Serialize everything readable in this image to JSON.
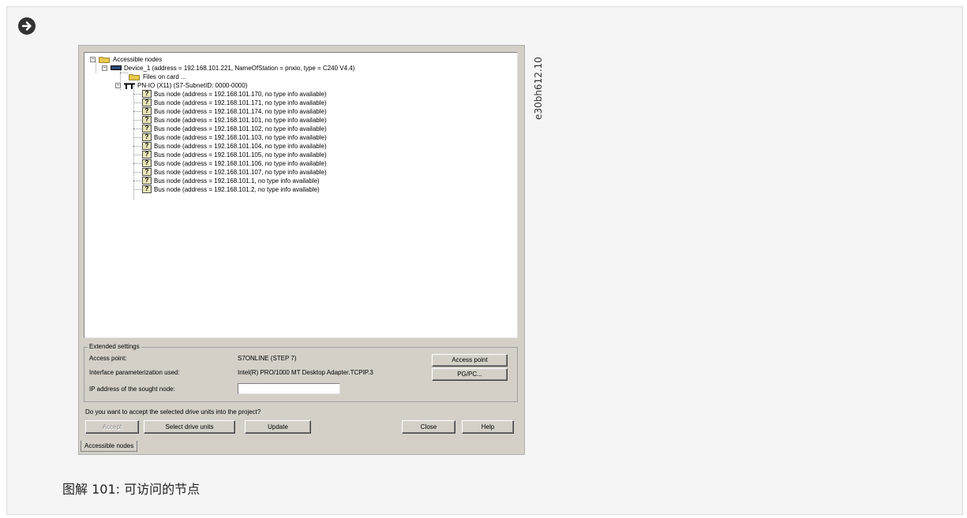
{
  "watermark": "e30bh612.10",
  "caption": "图解 101: 可访问的节点",
  "tree": {
    "root": "Accessible nodes",
    "device": "Device_1 (address = 192.168.101.221, NameOfStation = pnxio, type = C240 V4.4)",
    "files": "Files on card ...",
    "pnio": "PN-IO (X11) (S7-SubnetID: 0000-0000)",
    "bus_nodes": [
      "Bus node (address = 192.168.101.170, no type info available)",
      "Bus node (address = 192.168.101.171, no type info available)",
      "Bus node (address = 192.168.101.174, no type info available)",
      "Bus node (address = 192.168.101.101, no type info available)",
      "Bus node (address = 192.168.101.102, no type info available)",
      "Bus node (address = 192.168.101.103, no type info available)",
      "Bus node (address = 192.168.101.104, no type info available)",
      "Bus node (address = 192.168.101.105, no type info available)",
      "Bus node (address = 192.168.101.106, no type info available)",
      "Bus node (address = 192.168.101.107, no type info available)",
      "Bus node (address = 192.168.101.1, no type info available)",
      "Bus node (address = 192.168.101.2, no type info available)"
    ],
    "bus_icon_glyph": "?"
  },
  "extended": {
    "legend": "Extended settings",
    "access_point_label": "Access point:",
    "access_point_value": "S7ONLINE (STEP 7)",
    "interface_label": "Interface parameterization used:",
    "interface_value": "Intel(R) PRO/1000 MT Desktop Adapter.TCPIP.3",
    "ip_label": "IP address of the sought node:",
    "ip_value": "",
    "access_point_button": "Access point",
    "pgpc_button": "PG/PC..."
  },
  "question": "Do you want to accept the selected drive units into the project?",
  "buttons": {
    "accept": "Accept",
    "select": "Select drive units",
    "update": "Update",
    "close": "Close",
    "help": "Help"
  },
  "tab": "Accessible nodes",
  "colors": {
    "dialog_bg": "#d4d0c8",
    "folder": "#e8c84a",
    "device": "#2c4a7a"
  }
}
